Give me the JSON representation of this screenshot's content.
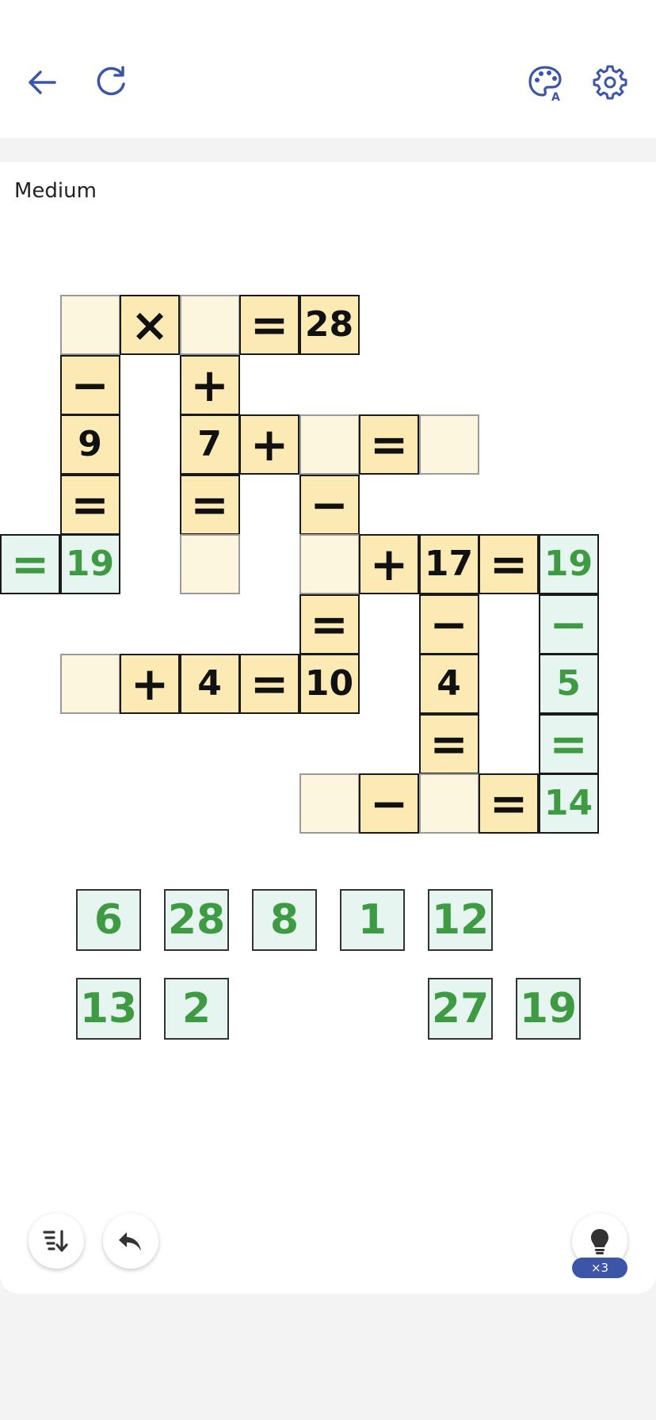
{
  "header": {
    "back_icon": "arrow-left-icon",
    "restart_icon": "refresh-icon",
    "theme_icon": "palette-icon",
    "settings_icon": "gear-icon",
    "accent": "#3d55a6"
  },
  "difficulty": "Medium",
  "colors": {
    "given_fill": "#fbeab4",
    "blank_fill": "#fdf6df",
    "placed_fill": "#e6f5ef",
    "placed_text": "#3e9a43"
  },
  "board": {
    "cells": [
      {
        "r": 0,
        "c": 1,
        "type": "blank",
        "v": ""
      },
      {
        "r": 0,
        "c": 2,
        "type": "given",
        "v": "×"
      },
      {
        "r": 0,
        "c": 3,
        "type": "blank",
        "v": ""
      },
      {
        "r": 0,
        "c": 4,
        "type": "given",
        "v": "="
      },
      {
        "r": 0,
        "c": 5,
        "type": "given",
        "v": "28"
      },
      {
        "r": 1,
        "c": 1,
        "type": "given",
        "v": "−"
      },
      {
        "r": 1,
        "c": 3,
        "type": "given",
        "v": "+"
      },
      {
        "r": 2,
        "c": 1,
        "type": "given",
        "v": "9"
      },
      {
        "r": 2,
        "c": 3,
        "type": "given",
        "v": "7"
      },
      {
        "r": 2,
        "c": 4,
        "type": "given",
        "v": "+"
      },
      {
        "r": 2,
        "c": 5,
        "type": "blank",
        "v": ""
      },
      {
        "r": 2,
        "c": 6,
        "type": "given",
        "v": "="
      },
      {
        "r": 2,
        "c": 7,
        "type": "blank",
        "v": ""
      },
      {
        "r": 3,
        "c": 1,
        "type": "given",
        "v": "="
      },
      {
        "r": 3,
        "c": 3,
        "type": "given",
        "v": "="
      },
      {
        "r": 3,
        "c": 5,
        "type": "given",
        "v": "−"
      },
      {
        "r": 4,
        "c": 0,
        "type": "placed",
        "v": "="
      },
      {
        "r": 4,
        "c": 1,
        "type": "placed",
        "v": "19"
      },
      {
        "r": 4,
        "c": 3,
        "type": "blank",
        "v": ""
      },
      {
        "r": 4,
        "c": 5,
        "type": "blank",
        "v": ""
      },
      {
        "r": 4,
        "c": 6,
        "type": "given",
        "v": "+"
      },
      {
        "r": 4,
        "c": 7,
        "type": "given",
        "v": "17"
      },
      {
        "r": 4,
        "c": 8,
        "type": "given",
        "v": "="
      },
      {
        "r": 4,
        "c": 9,
        "type": "placed",
        "v": "19"
      },
      {
        "r": 5,
        "c": 5,
        "type": "given",
        "v": "="
      },
      {
        "r": 5,
        "c": 7,
        "type": "given",
        "v": "−"
      },
      {
        "r": 5,
        "c": 9,
        "type": "placed",
        "v": "−"
      },
      {
        "r": 6,
        "c": 1,
        "type": "blank",
        "v": ""
      },
      {
        "r": 6,
        "c": 2,
        "type": "given",
        "v": "+"
      },
      {
        "r": 6,
        "c": 3,
        "type": "given",
        "v": "4"
      },
      {
        "r": 6,
        "c": 4,
        "type": "given",
        "v": "="
      },
      {
        "r": 6,
        "c": 5,
        "type": "given",
        "v": "10"
      },
      {
        "r": 6,
        "c": 7,
        "type": "given",
        "v": "4"
      },
      {
        "r": 6,
        "c": 9,
        "type": "placed",
        "v": "5"
      },
      {
        "r": 7,
        "c": 7,
        "type": "given",
        "v": "="
      },
      {
        "r": 7,
        "c": 9,
        "type": "placed",
        "v": "="
      },
      {
        "r": 8,
        "c": 5,
        "type": "blank",
        "v": ""
      },
      {
        "r": 8,
        "c": 6,
        "type": "given",
        "v": "−"
      },
      {
        "r": 8,
        "c": 7,
        "type": "blank",
        "v": ""
      },
      {
        "r": 8,
        "c": 8,
        "type": "given",
        "v": "="
      },
      {
        "r": 8,
        "c": 9,
        "type": "placed",
        "v": "14"
      }
    ]
  },
  "tiles": [
    {
      "v": "6",
      "row": 0,
      "col": 0
    },
    {
      "v": "28",
      "row": 0,
      "col": 1
    },
    {
      "v": "8",
      "row": 0,
      "col": 2
    },
    {
      "v": "1",
      "row": 0,
      "col": 3
    },
    {
      "v": "12",
      "row": 0,
      "col": 4
    },
    {
      "v": "13",
      "row": 1,
      "col": 0
    },
    {
      "v": "2",
      "row": 1,
      "col": 1
    },
    {
      "v": "27",
      "row": 1,
      "col": 4
    },
    {
      "v": "19",
      "row": 1,
      "col": 5
    }
  ],
  "footer": {
    "sort_icon": "sort-icon",
    "undo_icon": "undo-icon",
    "hint_icon": "lightbulb-icon",
    "hint_count": "×3"
  }
}
